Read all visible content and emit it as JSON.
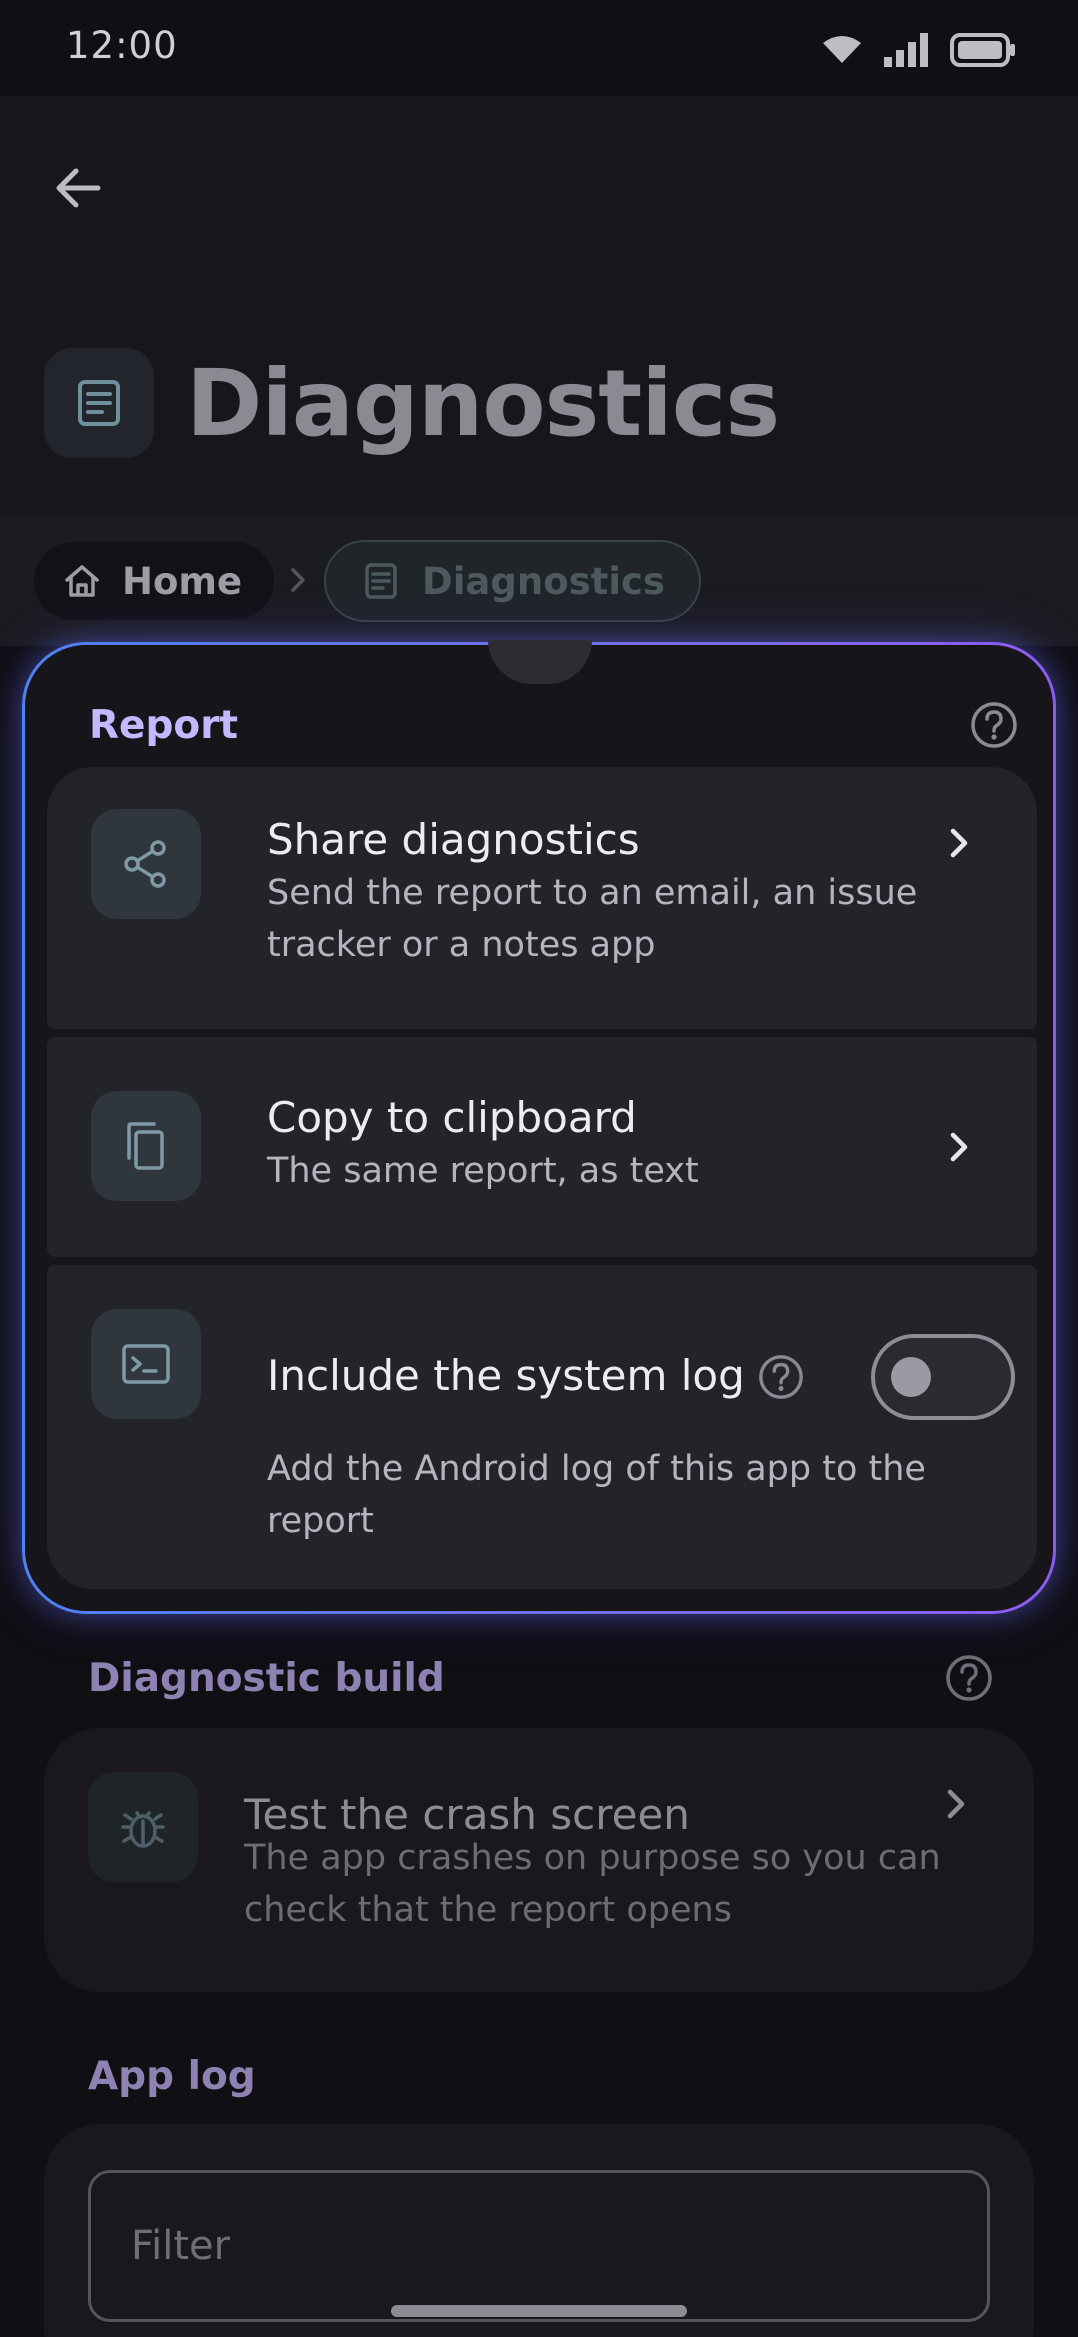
{
  "status_bar": {
    "time": "12:00",
    "icons": [
      "wifi-icon",
      "signal-icon",
      "battery-icon"
    ]
  },
  "header": {
    "title": "Diagnostics",
    "back_icon": "arrow-back-icon",
    "title_icon": "document-icon"
  },
  "breadcrumb": {
    "items": [
      {
        "label": "Home",
        "icon": "home-icon"
      },
      {
        "label": "Diagnostics",
        "icon": "document-icon"
      }
    ]
  },
  "report": {
    "title": "Report",
    "help_icon": "help-icon",
    "items": [
      {
        "title": "Share diagnostics",
        "subtitle": "Send the report to an email, an issue tracker or a notes app",
        "icon": "share-icon"
      },
      {
        "title": "Copy to clipboard",
        "subtitle": "The same report, as text",
        "icon": "copy-icon"
      }
    ],
    "toggle_item": {
      "title": "Include the system log",
      "subtitle": "Add the Android log of this app to the report",
      "icon": "terminal-icon",
      "enabled": false
    }
  },
  "diagnostic_build": {
    "title": "Diagnostic build",
    "help_icon": "help-icon",
    "item": {
      "title": "Test the crash screen",
      "subtitle": "The app crashes on purpose so you can check that the report opens",
      "icon": "bug-icon"
    }
  },
  "app_log": {
    "title": "App log",
    "filter_placeholder": "Filter"
  },
  "colors": {
    "accent": "#c6b8ff",
    "gradient_start": "#4d82f2",
    "gradient_end": "#8e5bef",
    "background": "#0f0f14"
  }
}
